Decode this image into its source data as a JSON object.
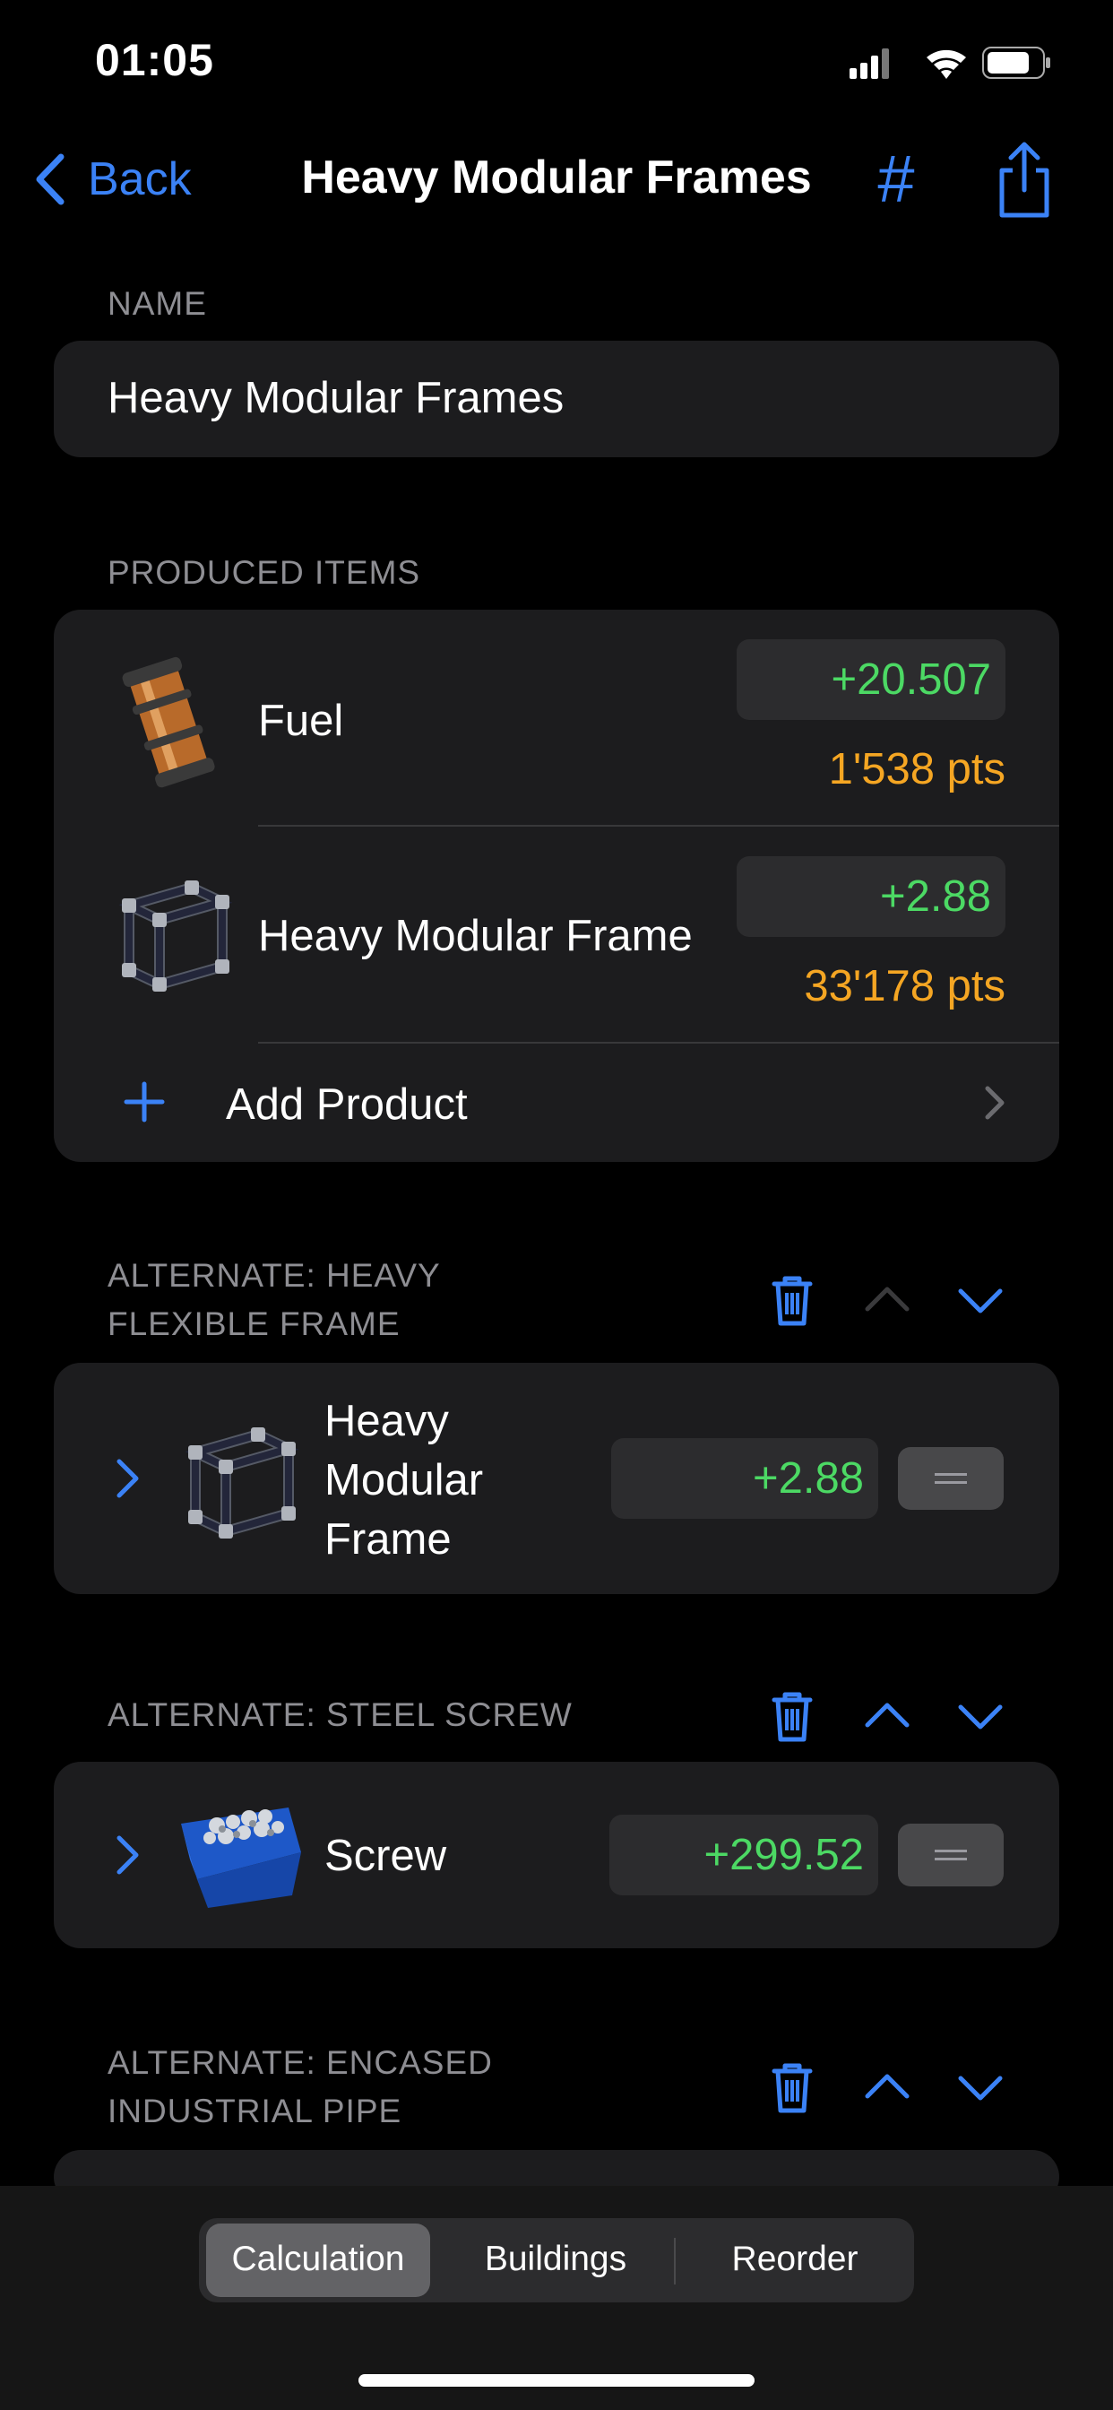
{
  "status": {
    "time": "01:05"
  },
  "nav": {
    "back_label": "Back",
    "title": "Heavy Modular Frames",
    "hash_label": "#"
  },
  "name_section": {
    "header": "NAME",
    "value": "Heavy Modular Frames"
  },
  "produced": {
    "header": "PRODUCED ITEMS",
    "items": [
      {
        "name": "Fuel",
        "value": "+20.507",
        "points": "1'538 pts"
      },
      {
        "name": "Heavy Modular Frame",
        "value": "+2.88",
        "points": "33'178 pts"
      }
    ],
    "add_label": "Add Product"
  },
  "recipes": [
    {
      "header_line1": "ALTERNATE: HEAVY",
      "header_line2": "FLEXIBLE FRAME",
      "item_line1": "Heavy",
      "item_line2": "Modular",
      "item_line3": "Frame",
      "value": "+2.88"
    },
    {
      "header": "ALTERNATE: STEEL SCREW",
      "item": "Screw",
      "value": "+299.52"
    },
    {
      "header_line1": "ALTERNATE: ENCASED",
      "header_line2": "INDUSTRIAL PIPE"
    }
  ],
  "segments": {
    "calculation": "Calculation",
    "buildings": "Buildings",
    "reorder": "Reorder",
    "selected": "Calculation"
  },
  "colors": {
    "accent": "#3b82f6",
    "positive": "#4cd964",
    "points": "#f5a623",
    "card": "#1c1c1e"
  }
}
